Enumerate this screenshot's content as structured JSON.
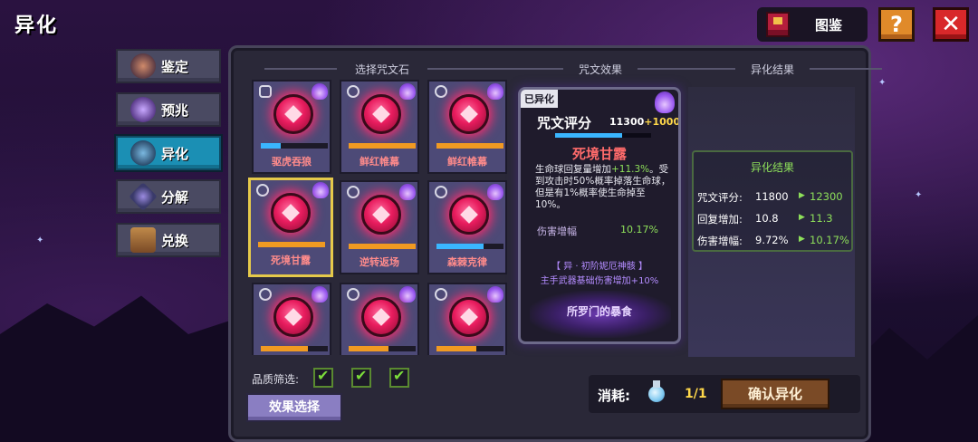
{
  "header": {
    "title": "异化",
    "codex_label": "图鉴",
    "help_label": "?",
    "close_label": "✕"
  },
  "tabs": [
    {
      "label": "鉴定",
      "icon": "anvil-icon"
    },
    {
      "label": "预兆",
      "icon": "crystal-ball-icon"
    },
    {
      "label": "异化",
      "icon": "demon-mask-icon",
      "active": true
    },
    {
      "label": "分解",
      "icon": "diamond-shatter-icon"
    },
    {
      "label": "兑换",
      "icon": "treasure-chest-icon"
    }
  ],
  "columns": {
    "select": "选择咒文石",
    "effect": "咒文效果",
    "result": "异化结果"
  },
  "cards": [
    {
      "name": "驱虎吞狼",
      "bar_percent": 30,
      "bar_color": "blue"
    },
    {
      "name": "鲜红帷幕",
      "bar_percent": 100,
      "bar_color": "orange"
    },
    {
      "name": "鲜红帷幕",
      "bar_percent": 100,
      "bar_color": "orange"
    },
    {
      "name": "死境甘露",
      "bar_percent": 100,
      "bar_color": "orange",
      "selected": true
    },
    {
      "name": "逆转返场",
      "bar_percent": 100,
      "bar_color": "orange"
    },
    {
      "name": "森棘克律",
      "bar_percent": 70,
      "bar_color": "blue"
    },
    {
      "name": "",
      "bar_percent": 70,
      "bar_color": "orange"
    },
    {
      "name": "",
      "bar_percent": 60,
      "bar_color": "orange"
    },
    {
      "name": "",
      "bar_percent": 60,
      "bar_color": "orange"
    }
  ],
  "effect": {
    "tag": "已异化",
    "score_label": "咒文评分",
    "score_value": "11300",
    "score_bonus": "+1000",
    "score_bar_percent": 70,
    "title": "死境甘露",
    "desc_1": "生命球回复量增加",
    "desc_highlight": "+11.3%",
    "desc_2": "。受到攻击时50%概率掉落生命球，但是有1%概率使生命掉至10%。",
    "stat_label": "伤害增幅",
    "stat_value": "10.17%",
    "affix": "【 异 · 初阶妮厄神骸 】",
    "affix_desc": "主手武器基础伤害增加+10%",
    "set_name": "所罗门的暴食"
  },
  "result": {
    "title": "异化结果",
    "rows": [
      {
        "label": "咒文评分:",
        "old": "11800",
        "arrow": "▶",
        "new": "12300"
      },
      {
        "label": "回复增加:",
        "old": "10.8",
        "arrow": "▶",
        "new": "11.3"
      },
      {
        "label": "伤害增幅:",
        "old": "9.72%",
        "arrow": "▶",
        "new": "10.17%"
      }
    ]
  },
  "bottom": {
    "filter_label": "品质筛选:",
    "effect_button": "效果选择",
    "cost_label": "消耗:",
    "cost_value": "1/1",
    "confirm_button": "确认异化"
  },
  "colors": {
    "accent_blue": "#1b8fb4",
    "selected_gold": "#e5c94a",
    "positive_green": "#8ee05a",
    "rune_red": "#e81c5e"
  }
}
